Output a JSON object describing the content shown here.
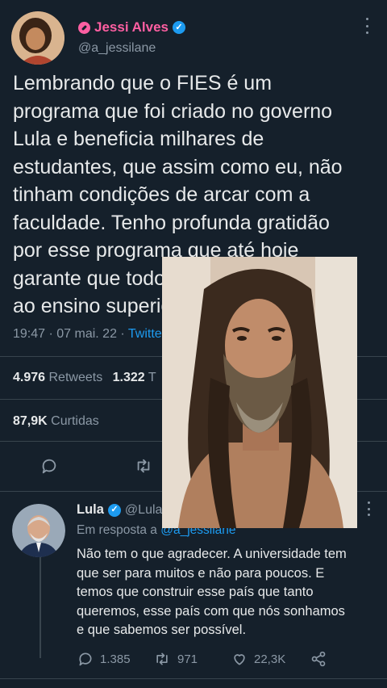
{
  "tweet": {
    "author": {
      "display_name": "Jessi Alves",
      "handle": "@a_jessilane",
      "name_color": "#ff5fa2"
    },
    "text": "Lembrando que o FIES é um\nprograma que foi criado no governo\nLula e beneficia milhares de\nestudantes, que assim como eu, não\ntinham condições de arcar com a\nfaculdade. Tenho profunda gratidão\npor esse programa que até hoje\ngarante que todos possam ter acesso\nao ensino superior.",
    "time": "19:47 · 07 mai. 22 · ",
    "source": "Twitter",
    "retweets_count": "4.976",
    "retweets_label": "Retweets",
    "quotes_count": "1.322",
    "quotes_label": "T",
    "likes_count": "87,9K",
    "likes_label": "Curtidas"
  },
  "reply": {
    "author": {
      "display_name": "Lula",
      "handle": "@Lula"
    },
    "reply_to_prefix": "Em resposta a ",
    "reply_to_handle": "@a_jessilane",
    "text": "Não tem o que agradecer. A universidade tem\nque ser para muitos e não para poucos. E\ntemos que construir esse país que tanto\nqueremos, esse país com que nós sonhamos\ne que sabemos ser possível.",
    "reply_count": "1.385",
    "retweet_count": "971",
    "like_count": "22,3K"
  },
  "icons": [
    "verified-badge",
    "more-icon",
    "reply-icon",
    "retweet-icon",
    "like-icon",
    "share-icon",
    "brand-badge"
  ],
  "colors": {
    "background": "#15202b",
    "accent": "#1d9bf0",
    "muted": "#8b98a5",
    "divider": "#38444d"
  }
}
